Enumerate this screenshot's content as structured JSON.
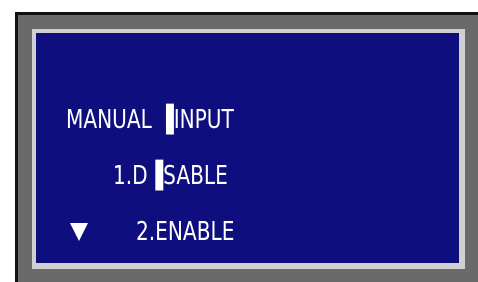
{
  "screen": {
    "title": "MANUAL ▐INPUT",
    "menu_items": [
      {
        "label": "1.D▐SABLE",
        "selected": false
      },
      {
        "label": "2.ENABLE",
        "selected": true
      }
    ],
    "cursor_icon": "down-triangle-icon"
  },
  "colors": {
    "lcd_background": "#0e0e7e",
    "lcd_text": "#ffffff",
    "frame": "#6a6a6a",
    "bezel": "#d0d0d0"
  }
}
